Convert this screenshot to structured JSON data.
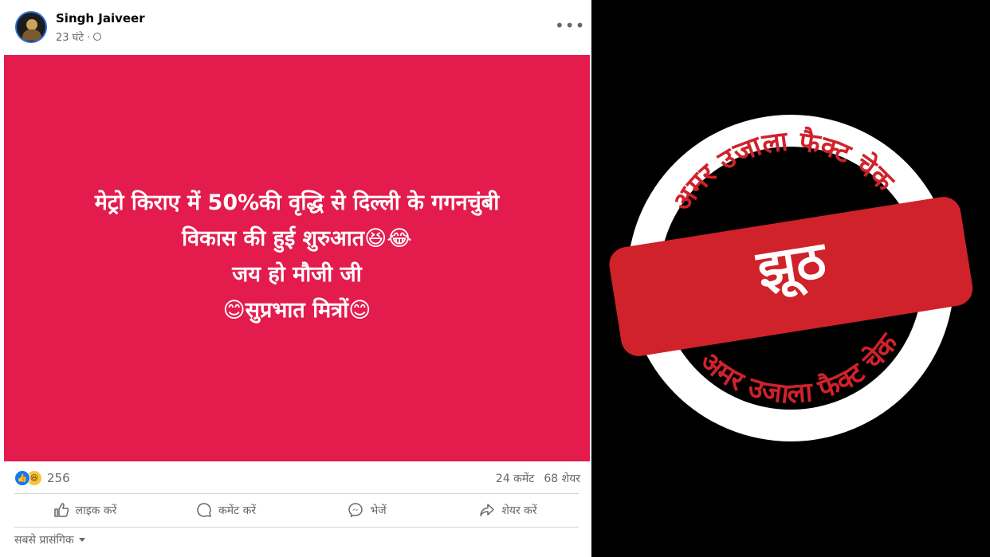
{
  "post": {
    "author": "Singh Jaiveer",
    "time": "23 घंटे ·",
    "more_label": "•••",
    "lines": [
      "मेट्रो किराए में 50%की वृद्धि से दिल्ली के गगनचुंबी",
      "विकास की हुई शुरुआत😆😂",
      "जय हो मौजी जी",
      "😊सुप्रभात मित्रों😊"
    ],
    "image_bg_color": "#e41b4d"
  },
  "stats": {
    "reaction_count": "256",
    "comments": "24 कमेंट",
    "shares": "68 शेयर"
  },
  "actions": {
    "like": "लाइक करें",
    "comment": "कमेंट करें",
    "send": "भेजें",
    "share": "शेयर करें"
  },
  "sort": {
    "label": "सबसे प्रासंगिक"
  },
  "stamp": {
    "verdict": "झूठ",
    "ring_text_top": "अमर उजाला फैक्ट चेक",
    "ring_text_bottom": "अमर उजाला फैक्ट चेक",
    "color": "#d0222a"
  }
}
